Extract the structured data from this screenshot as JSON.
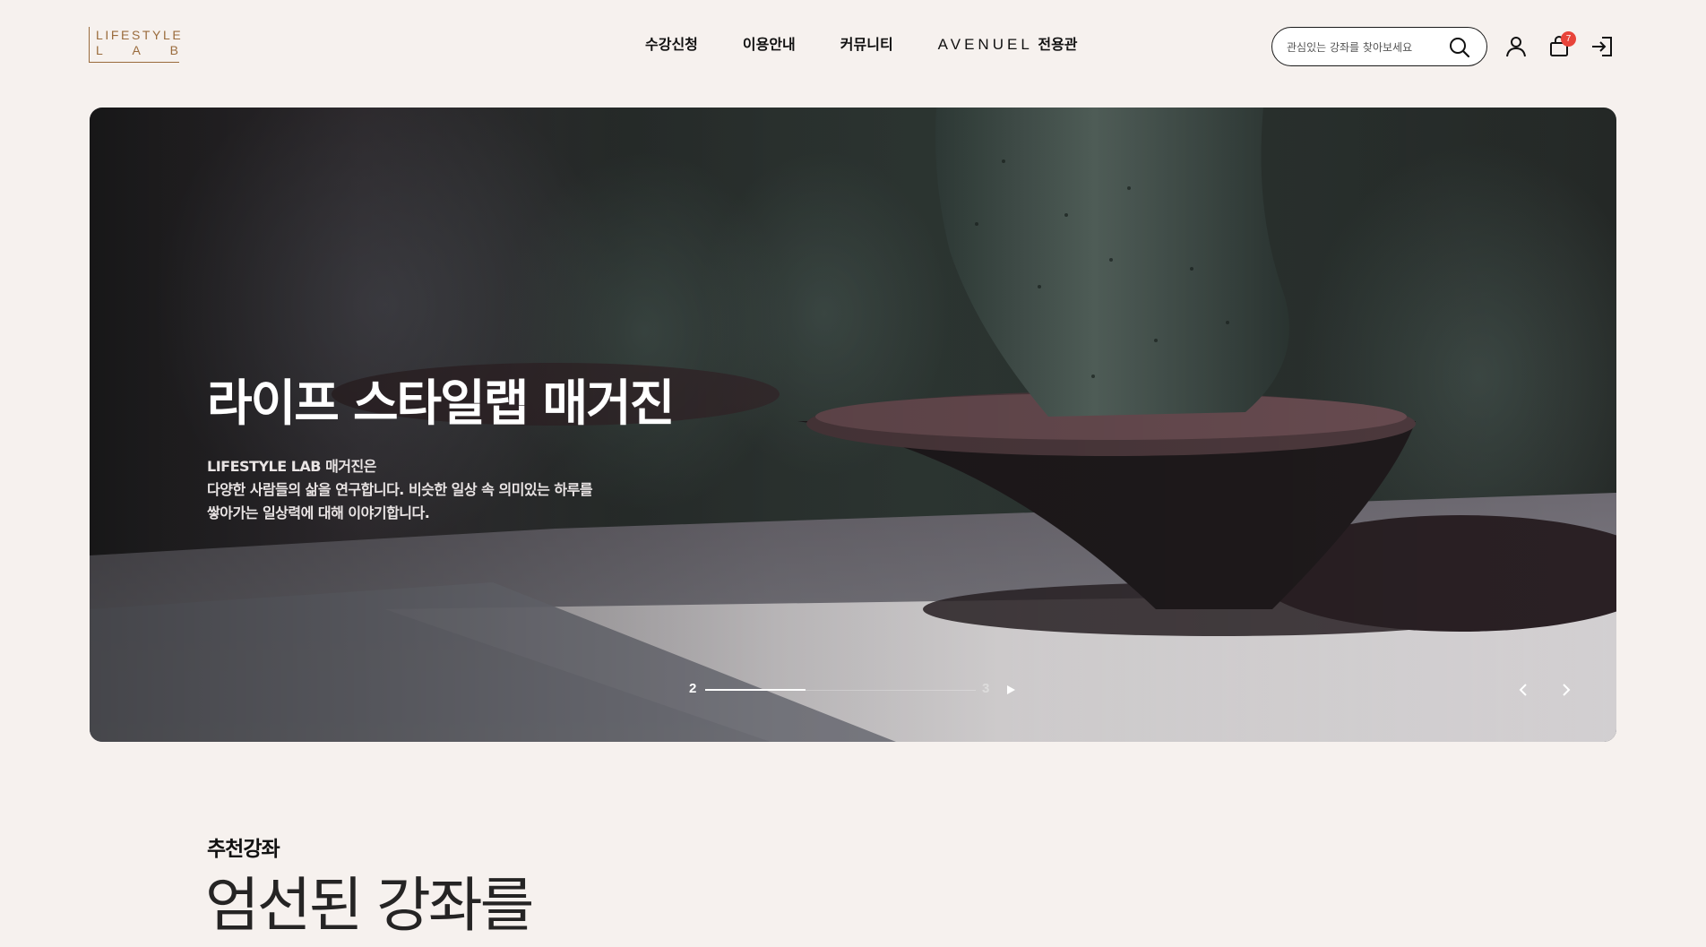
{
  "brand": {
    "logo_line1": "LIFESTYLE",
    "logo_line2": [
      "L",
      "A",
      "B"
    ],
    "accent_color": "#9a6b3c"
  },
  "nav": {
    "items": [
      {
        "label": "수강신청"
      },
      {
        "label": "이용안내"
      },
      {
        "label": "커뮤니티"
      }
    ],
    "special": {
      "brand": "AVENUEL",
      "suffix": " 전용관"
    }
  },
  "search": {
    "placeholder": "관심있는 강좌를 찾아보세요",
    "icon": "search-icon"
  },
  "utility": {
    "user_icon": "user-icon",
    "cart_icon": "shopping-bag-icon",
    "cart_count": "7",
    "cart_badge_color": "#e8443a",
    "login_icon": "login-icon"
  },
  "hero": {
    "title": "라이프 스타일랩 매거진",
    "description": [
      "LIFESTYLE LAB 매거진은",
      "다양한 사람들의 삶을 연구합니다. 비슷한 일상 속 의미있는 하루를",
      "쌓아가는 일상력에 대해 이야기합니다."
    ],
    "pager": {
      "current": "2",
      "total": "3",
      "progress": 0.37
    },
    "prev_icon": "chevron-left-icon",
    "next_icon": "chevron-right-icon",
    "play_icon": "play-icon"
  },
  "section": {
    "label": "추천강좌",
    "heading": "엄선된 강좌를"
  }
}
